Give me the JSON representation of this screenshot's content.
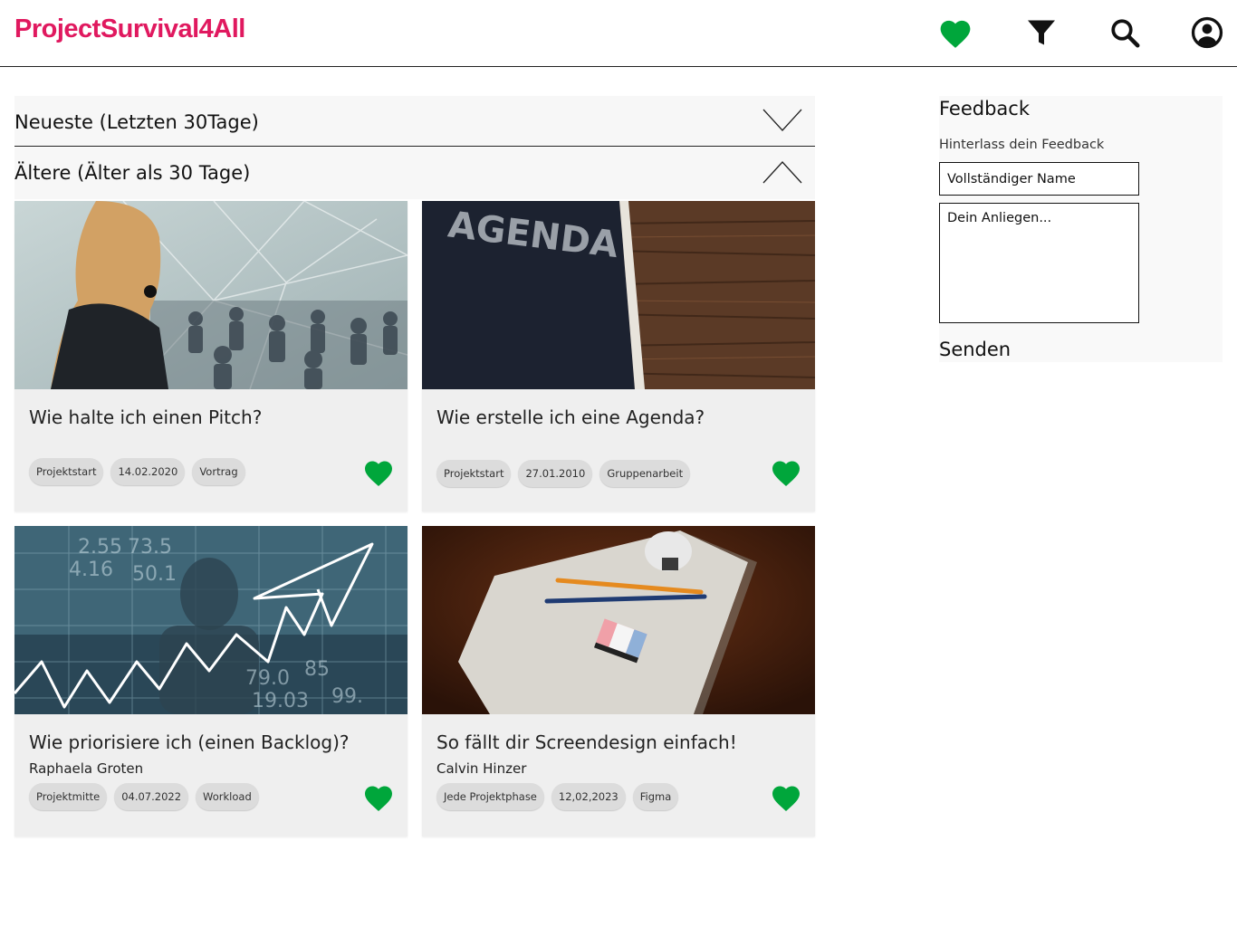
{
  "colors": {
    "brand": "#e0195f",
    "favorite": "#00a63b"
  },
  "header": {
    "logo": "ProjectSurvival4All",
    "icons": [
      "heart-icon",
      "filter-icon",
      "search-icon",
      "account-icon"
    ]
  },
  "sections": {
    "newest": {
      "label": "Neueste (Letzten 30Tage)",
      "state": "collapsed"
    },
    "older": {
      "label": "Ältere (Älter als 30 Tage)",
      "state": "expanded"
    }
  },
  "cards": [
    {
      "image": "presentation-photo",
      "title": "Wie halte ich einen Pitch?",
      "author": "",
      "tags": [
        "Projektstart",
        "14.02.2020",
        "Vortrag"
      ]
    },
    {
      "image": "agenda-book-photo",
      "title": "Wie erstelle ich eine Agenda?",
      "author": "",
      "tags": [
        "Projektstart",
        "27.01.2010",
        "Gruppenarbeit"
      ]
    },
    {
      "image": "growth-chart-photo",
      "title": "Wie priorisiere ich (einen Backlog)?",
      "author": "Raphaela Groten",
      "tags": [
        "Projektmitte",
        "04.07.2022",
        "Workload"
      ]
    },
    {
      "image": "paper-pencils-photo",
      "title": "So fällt dir Screendesign einfach!",
      "author": "Calvin Hinzer",
      "tags": [
        "Jede Projektphase",
        "12,02,2023",
        "Figma"
      ]
    }
  ],
  "feedback": {
    "title": "Feedback",
    "subtitle": "Hinterlass dein Feedback",
    "name_placeholder": "Vollständiger Name",
    "message_placeholder": "Dein Anliegen...",
    "send_label": "Senden"
  }
}
